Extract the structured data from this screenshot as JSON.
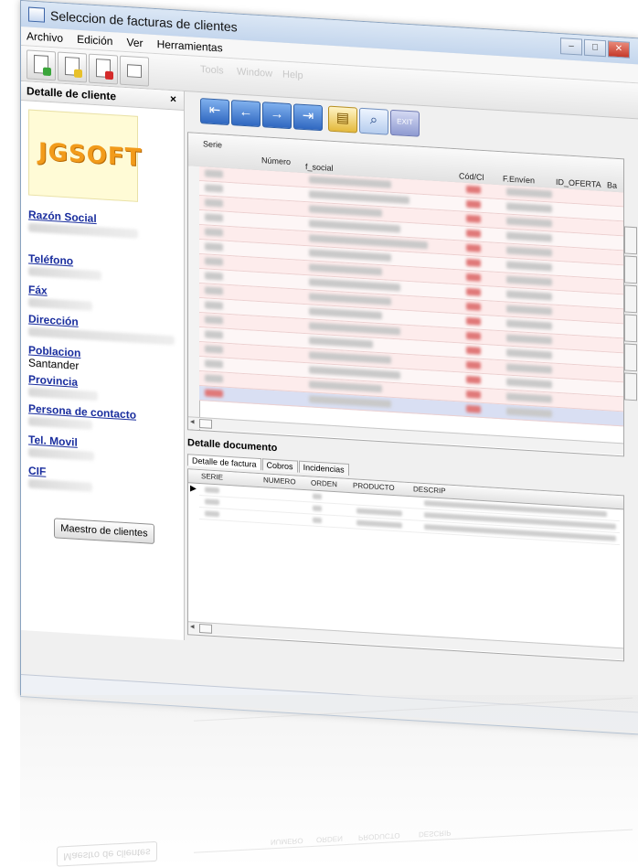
{
  "window": {
    "title": "Seleccion de facturas de clientes"
  },
  "menu": [
    "Archivo",
    "Edición",
    "Ver",
    "Herramientas"
  ],
  "ghost_menu": [
    "Tools",
    "Window",
    "Help"
  ],
  "left_panel": {
    "title": "Detalle de cliente",
    "close": "×",
    "logo": "JGSOFT",
    "fields": [
      {
        "label": "Razón Social",
        "value": ""
      },
      {
        "label": "Teléfono",
        "value": ""
      },
      {
        "label": "Fáx",
        "value": ""
      },
      {
        "label": "Dirección",
        "value": ""
      },
      {
        "label": "Poblacion",
        "value": "Santander"
      },
      {
        "label": "Provincia",
        "value": ""
      },
      {
        "label": "Persona de contacto",
        "value": ""
      },
      {
        "label": "Tel. Movil",
        "value": ""
      },
      {
        "label": "CIF",
        "value": ""
      }
    ],
    "button": "Maestro de clientes"
  },
  "nav": {
    "exit_label": "EXIT"
  },
  "grid": {
    "columns": [
      "Serie",
      "Número",
      "f_social",
      "Cód/Cl",
      "F.Envíen",
      "ID_OFERTA",
      "Ba"
    ]
  },
  "detail": {
    "title": "Detalle documento",
    "tabs": [
      "Detalle de factura",
      "Cobros",
      "Incidencias"
    ],
    "columns": [
      "SERIE",
      "NUMERO",
      "ORDEN",
      "PRODUCTO",
      "DESCRIP"
    ]
  },
  "reflection": {
    "button": "Maestro de clientes",
    "columns": [
      "NUMERO",
      "ORDEN",
      "PRODUCTO",
      "DESCRIP"
    ]
  }
}
